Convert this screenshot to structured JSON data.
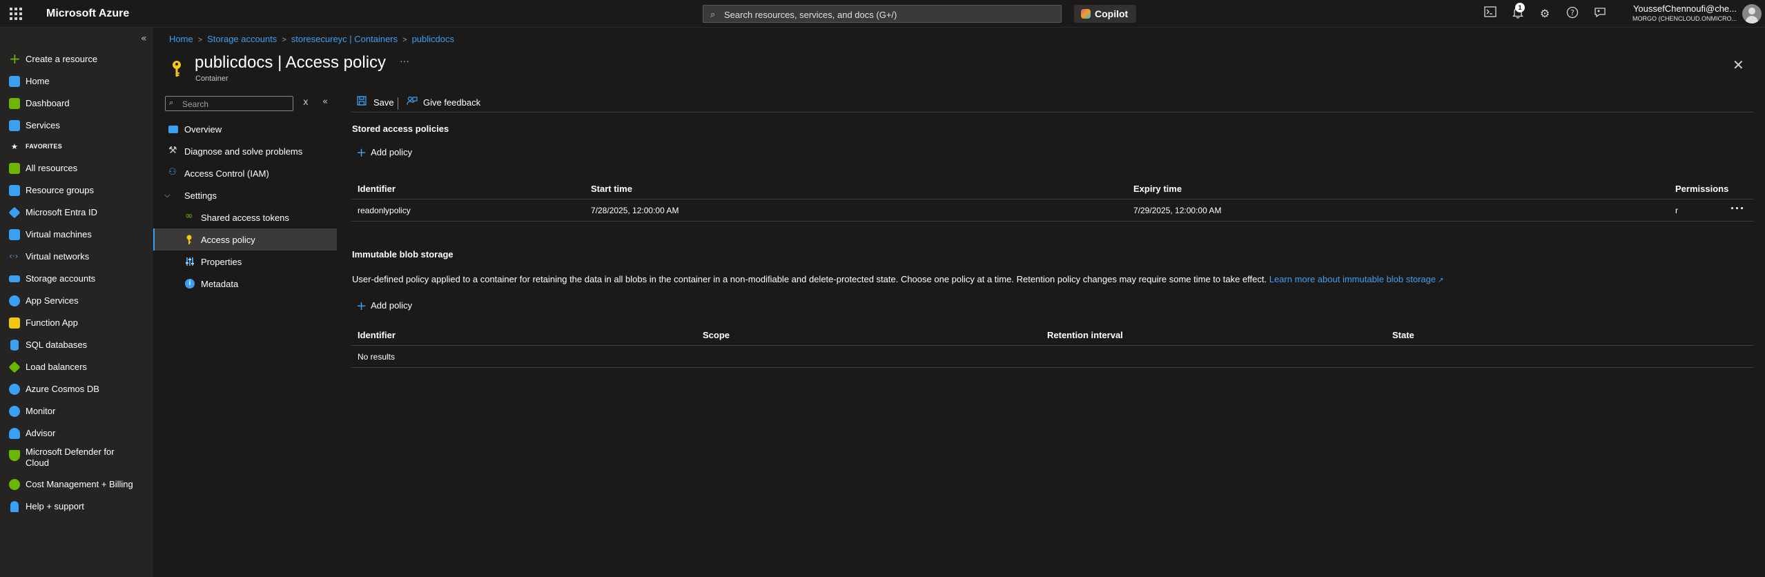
{
  "topbar": {
    "brand": "Microsoft Azure",
    "search_placeholder": "Search resources, services, and docs (G+/)",
    "copilot_label": "Copilot",
    "notification_count": "1",
    "user_name": "YoussefChennoufi@che...",
    "user_tenant": "MORGO (CHENCLOUD.ONMICRO..."
  },
  "leftnav": {
    "collapse": "«",
    "favorites_heading": "FAVORITES",
    "items": [
      {
        "label": "Create a resource",
        "color": "#6bb700"
      },
      {
        "label": "Home",
        "color": "#3aa0f3"
      },
      {
        "label": "Dashboard",
        "color": "#6bb700"
      },
      {
        "label": "Services",
        "color": "#3aa0f3"
      },
      {
        "label": "All resources",
        "color": "#6bb700"
      },
      {
        "label": "Resource groups",
        "color": "#3aa0f3"
      },
      {
        "label": "Microsoft Entra ID",
        "color": "#3aa0f3"
      },
      {
        "label": "Virtual machines",
        "color": "#3aa0f3"
      },
      {
        "label": "Virtual networks",
        "color": "#3aa0f3"
      },
      {
        "label": "Storage accounts",
        "color": "#3aa0f3"
      },
      {
        "label": "App Services",
        "color": "#3aa0f3"
      },
      {
        "label": "Function App",
        "color": "#f2c811"
      },
      {
        "label": "SQL databases",
        "color": "#3aa0f3"
      },
      {
        "label": "Load balancers",
        "color": "#6bb700"
      },
      {
        "label": "Azure Cosmos DB",
        "color": "#3aa0f3"
      },
      {
        "label": "Monitor",
        "color": "#3aa0f3"
      },
      {
        "label": "Advisor",
        "color": "#3aa0f3"
      },
      {
        "label": "Microsoft Defender for Cloud",
        "color": "#6bb700"
      },
      {
        "label": "Cost Management + Billing",
        "color": "#6bb700"
      },
      {
        "label": "Help + support",
        "color": "#3aa0f3"
      }
    ]
  },
  "breadcrumb": [
    "Home",
    "Storage accounts",
    "storesecureyc | Containers",
    "publicdocs"
  ],
  "page": {
    "title": "publicdocs | Access policy",
    "subtitle": "Container",
    "more": "···",
    "close": "✕"
  },
  "resource_menu": {
    "search_placeholder": "Search",
    "clear": "x",
    "collapse": "«",
    "items": [
      {
        "label": "Overview"
      },
      {
        "label": "Diagnose and solve problems"
      },
      {
        "label": "Access Control (IAM)"
      },
      {
        "label": "Settings"
      },
      {
        "label": "Shared access tokens"
      },
      {
        "label": "Access policy"
      },
      {
        "label": "Properties"
      },
      {
        "label": "Metadata"
      }
    ]
  },
  "commands": {
    "save": "Save",
    "feedback": "Give feedback"
  },
  "stored_policies": {
    "title": "Stored access policies",
    "add": "Add policy",
    "columns": [
      "Identifier",
      "Start time",
      "Expiry time",
      "Permissions"
    ],
    "rows": [
      {
        "identifier": "readonlypolicy",
        "start": "7/28/2025, 12:00:00 AM",
        "expiry": "7/29/2025, 12:00:00 AM",
        "permissions": "r"
      }
    ],
    "row_more": "···"
  },
  "immutable": {
    "title": "Immutable blob storage",
    "description": "User-defined policy applied to a container for retaining the data in all blobs in the container in a non-modifiable and delete-protected state. Choose one policy at a time. Retention policy changes may require some time to take effect.",
    "learn_more": "Learn more about immutable blob storage",
    "add": "Add policy",
    "columns": [
      "Identifier",
      "Scope",
      "Retention interval",
      "State"
    ],
    "empty": "No results"
  }
}
